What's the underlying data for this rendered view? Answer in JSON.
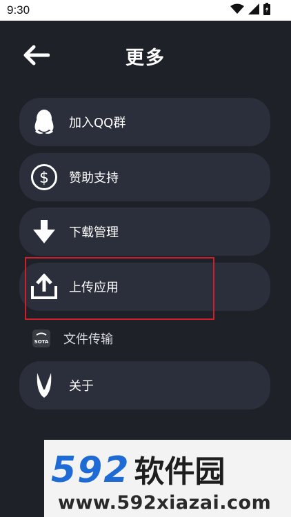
{
  "status_bar": {
    "time": "9:30"
  },
  "header": {
    "title": "更多"
  },
  "menu": [
    {
      "label": "加入QQ群",
      "icon": "qq-penguin-icon"
    },
    {
      "label": "赞助支持",
      "icon": "dollar-icon"
    },
    {
      "label": "下载管理",
      "icon": "download-arrow-icon"
    },
    {
      "label": "上传应用",
      "icon": "upload-icon"
    },
    {
      "label": "文件传输",
      "icon": "sota-app-icon",
      "icon_text": "SOTA"
    },
    {
      "label": "关于",
      "icon": "app-logo-icon"
    }
  ],
  "watermark": {
    "brand_number": "592",
    "brand_name": "软件园",
    "url": "www.592xiazai.com"
  },
  "colors": {
    "background": "#1f2129",
    "card": "#2b2e3b",
    "highlight": "#d01f2b",
    "watermark_blue": "#1f6bd6"
  }
}
